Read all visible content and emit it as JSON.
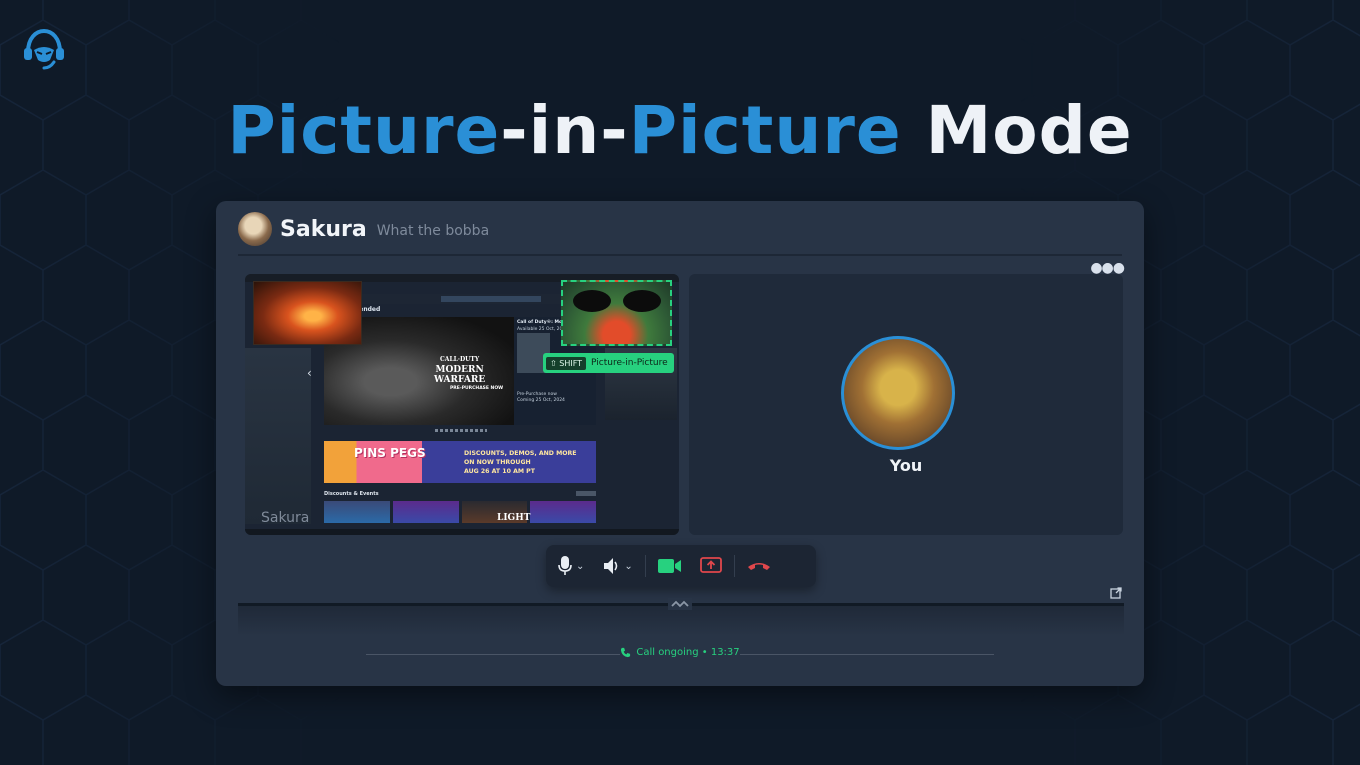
{
  "headline": {
    "part1": "Picture",
    "part2": "-in-",
    "part3": "Picture",
    "part4": " Mode"
  },
  "chat": {
    "contact_name": "Sakura",
    "contact_status": "What the bobba"
  },
  "call": {
    "left_tile_name": "Sakura",
    "right_tile_name": "You",
    "pip_shift_key": "⇧ SHIFT",
    "pip_label": "Picture-in-Picture",
    "status_text": "Call ongoing • 13:37"
  },
  "screen_share": {
    "recommended": "mended",
    "hero_title_line1": "CALL·DUTY",
    "hero_title_line2": "MODERN",
    "hero_title_line3": "WARFARE",
    "hero_sub": "PRE-PURCHASE NOW",
    "side_title": "Call of Duty®: Mode",
    "side_avail": "Available 25 Oct, 2024",
    "side_prepurchase": "Pre-Purchase now",
    "side_coming": "Coming 25 Oct, 2024",
    "banner_logo": "PINS PEGS",
    "banner_text_1": "DISCOUNTS, DEMOS, AND MORE",
    "banner_text_2": "ON NOW THROUGH",
    "banner_text_3": "AUG 26 AT 10 AM PT",
    "discounts": "Discounts & Events",
    "card_light": "LIGHT"
  },
  "colors": {
    "accent_blue": "#2a8fd6",
    "accent_green": "#27d17f",
    "danger_red": "#e0474c"
  },
  "icons": {
    "logo": "headset-logo-icon",
    "mic": "microphone-icon",
    "speaker": "speaker-icon",
    "camera": "video-camera-icon",
    "share": "screen-share-icon",
    "hangup": "hang-up-icon",
    "popout": "popout-icon",
    "more": "more-options-icon",
    "phone": "phone-icon"
  }
}
